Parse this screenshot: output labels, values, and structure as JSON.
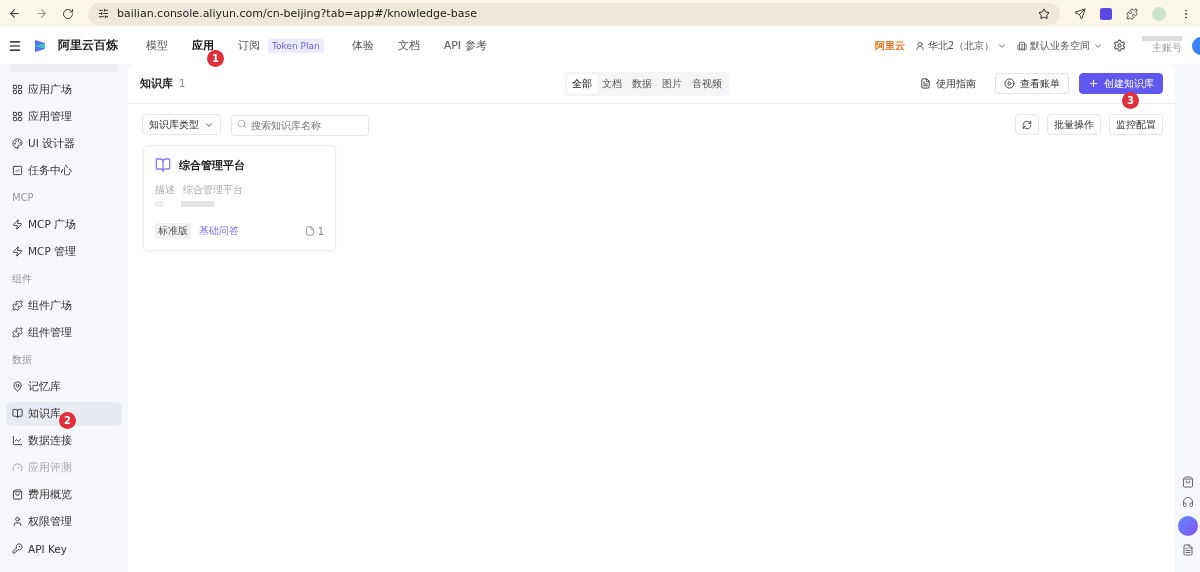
{
  "browser": {
    "url": "bailian.console.aliyun.com/cn-beijing?tab=app#/knowledge-base"
  },
  "header": {
    "brand": "阿里云百炼",
    "nav": [
      {
        "label": "模型",
        "selected": false
      },
      {
        "label": "应用",
        "selected": true
      },
      {
        "label": "订阅",
        "selected": false,
        "tag": "Token Plan"
      },
      {
        "label": "体验",
        "selected": false
      },
      {
        "label": "文档",
        "selected": false
      },
      {
        "label": "API 参考",
        "selected": false
      }
    ],
    "cloud_logo": "阿里云",
    "region": "华北2（北京）",
    "workspace": "默认业务空间",
    "account_role": "主账号"
  },
  "sidebar": {
    "sections": [
      {
        "items": [
          {
            "label": "应用广场",
            "selected": false,
            "disabled": false
          },
          {
            "label": "应用管理",
            "selected": false,
            "disabled": false
          },
          {
            "label": "UI 设计器",
            "selected": false,
            "disabled": false
          },
          {
            "label": "任务中心",
            "selected": false,
            "disabled": false
          }
        ]
      },
      {
        "title": "MCP",
        "items": [
          {
            "label": "MCP 广场",
            "selected": false,
            "disabled": false
          },
          {
            "label": "MCP 管理",
            "selected": false,
            "disabled": false
          }
        ]
      },
      {
        "title": "组件",
        "items": [
          {
            "label": "组件广场",
            "selected": false,
            "disabled": false
          },
          {
            "label": "组件管理",
            "selected": false,
            "disabled": false
          }
        ]
      },
      {
        "title": "数据",
        "items": [
          {
            "label": "记忆库",
            "selected": false,
            "disabled": false
          },
          {
            "label": "知识库",
            "selected": true,
            "disabled": false
          },
          {
            "label": "数据连接",
            "selected": false,
            "disabled": false
          },
          {
            "label": "应用评测",
            "selected": false,
            "disabled": true
          },
          {
            "label": "费用概览",
            "selected": false,
            "disabled": false
          },
          {
            "label": "权限管理",
            "selected": false,
            "disabled": false
          },
          {
            "label": "API Key",
            "selected": false,
            "disabled": false
          }
        ]
      }
    ]
  },
  "page": {
    "title": "知识库",
    "count": "1",
    "filters": [
      {
        "label": "全部",
        "selected": true
      },
      {
        "label": "文档",
        "selected": false
      },
      {
        "label": "数据",
        "selected": false
      },
      {
        "label": "图片",
        "selected": false
      },
      {
        "label": "音视频",
        "selected": false
      }
    ],
    "actions": [
      {
        "label": "使用指南",
        "kind": "link"
      },
      {
        "label": "查看账单",
        "kind": "outline"
      },
      {
        "label": "创建知识库",
        "kind": "primary"
      }
    ],
    "type_select": "知识库类型",
    "search": {
      "placeholder": "搜索知识库名称"
    },
    "toolbar_buttons": [
      "批量操作",
      "监控配置"
    ],
    "cards": [
      {
        "title": "综合管理平台",
        "desc_label": "描述",
        "desc": "综合管理平台",
        "edition": "标准版",
        "type": "基础问答",
        "doc_count": "1"
      }
    ]
  },
  "annotations": [
    "1",
    "2",
    "3"
  ]
}
